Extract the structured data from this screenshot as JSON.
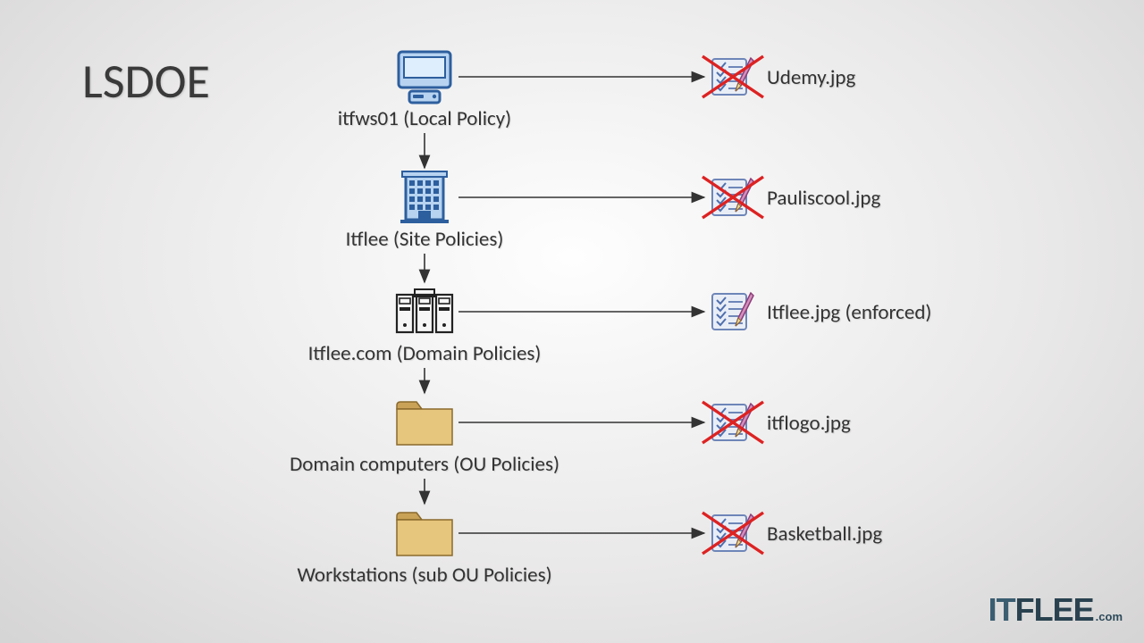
{
  "title": "LSDOE",
  "brand": {
    "it": "IT",
    "flee": "FLEE",
    "com": ".com"
  },
  "levels": [
    {
      "icon": "computer",
      "label": "itfws01 (Local Policy)",
      "gpo": "Udemy.jpg",
      "crossed": true
    },
    {
      "icon": "building",
      "label": "Itflee (Site Policies)",
      "gpo": "Pauliscool.jpg",
      "crossed": true
    },
    {
      "icon": "servers",
      "label": "Itflee.com (Domain Policies)",
      "gpo": "Itflee.jpg (enforced)",
      "crossed": false
    },
    {
      "icon": "folder",
      "label": "Domain computers (OU Policies)",
      "gpo": "itflogo.jpg",
      "crossed": true
    },
    {
      "icon": "folder",
      "label": "Workstations (sub OU Policies)",
      "gpo": "Basketball.jpg",
      "crossed": true
    }
  ],
  "layout": {
    "iconCenterX": 475,
    "rowTop": [
      55,
      190,
      318,
      442,
      566
    ],
    "gpoIconCenterX": 820,
    "gpoLabelLeft": 858
  }
}
